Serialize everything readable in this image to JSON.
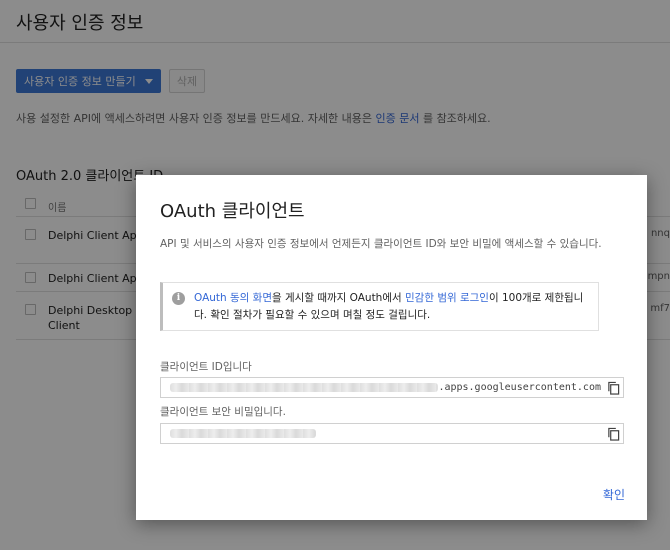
{
  "page": {
    "title": "사용자 인증 정보",
    "create_button": "사용자 인증 정보 만들기",
    "delete_button": "삭제",
    "description_pre": "사용 설정한 API에 액세스하려면 사용자 인증 정보를 만드세요. 자세한 내용은 ",
    "description_link": "인증 문서",
    "description_post": " 를 참조하세요.",
    "section_title": "OAuth 2.0 클라이언트 ID",
    "table": {
      "header_name": "이름",
      "rows": [
        {
          "name": "Delphi Client App",
          "clipped": "nnq"
        },
        {
          "name": "Delphi Client App",
          "clipped": "mpn"
        },
        {
          "name": "Delphi Desktop Client",
          "clipped": "mf7"
        }
      ]
    }
  },
  "dialog": {
    "title": "OAuth 클라이언트",
    "body": "API 및 서비스의 사용자 인증 정보에서 언제든지 클라이언트 ID와 보안 비밀에 액세스할 수 있습니다.",
    "notice": {
      "link1": "OAuth 동의 화면",
      "text1": "을 게시할 때까지 OAuth에서 ",
      "link2": "민감한 범위 로그인",
      "text2": "이 100개로 제한됩니다. 확인 절차가 필요할 수 있으며 며칠 정도 걸립니다."
    },
    "client_id_label": "클라이언트 ID입니다",
    "client_id_suffix": ".apps.googleusercontent.com",
    "client_secret_label": "클라이언트 보안 비밀입니다.",
    "ok_button": "확인"
  },
  "colors": {
    "primary": "#3c78d8",
    "link": "#3367d6"
  },
  "icons": [
    "info-icon",
    "copy-icon",
    "chevron-down-icon"
  ]
}
